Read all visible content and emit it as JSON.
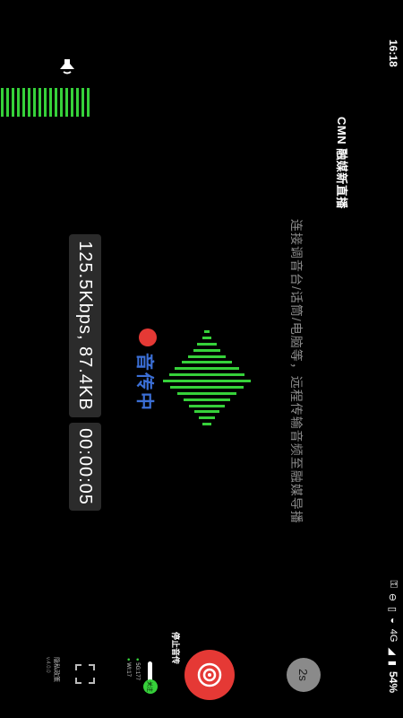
{
  "status_bar": {
    "time": "16:18",
    "network": "4G",
    "battery": "54%",
    "icons": [
      "key-icon",
      "no-disturb-icon",
      "vibrate-icon",
      "wifi-icon",
      "signal-icon",
      "battery-icon"
    ]
  },
  "header": {
    "title": "CMN 融媒新直播"
  },
  "instruction": "连接调音台/话筒/电脑等，远程传输音频至融媒导播",
  "level_meter": {
    "icon": "speaker-icon",
    "level": 0.95,
    "color": "#36d13a"
  },
  "waveform": {
    "color": "#36d13a"
  },
  "recording": {
    "label": "音传中",
    "dot_color": "#e53935",
    "label_color": "#3b6fd6"
  },
  "stats": {
    "bitrate_size": "125.5Kbps, 87.4KB",
    "elapsed": "00:00:05"
  },
  "controls": {
    "mini_button_label": "2s",
    "stop_label": "停止音传",
    "network": {
      "knob_label": "关注",
      "line1": "5G:177",
      "line2": "WI:17"
    },
    "settings_label": "隐私政策",
    "version": "v.4.0.0"
  }
}
